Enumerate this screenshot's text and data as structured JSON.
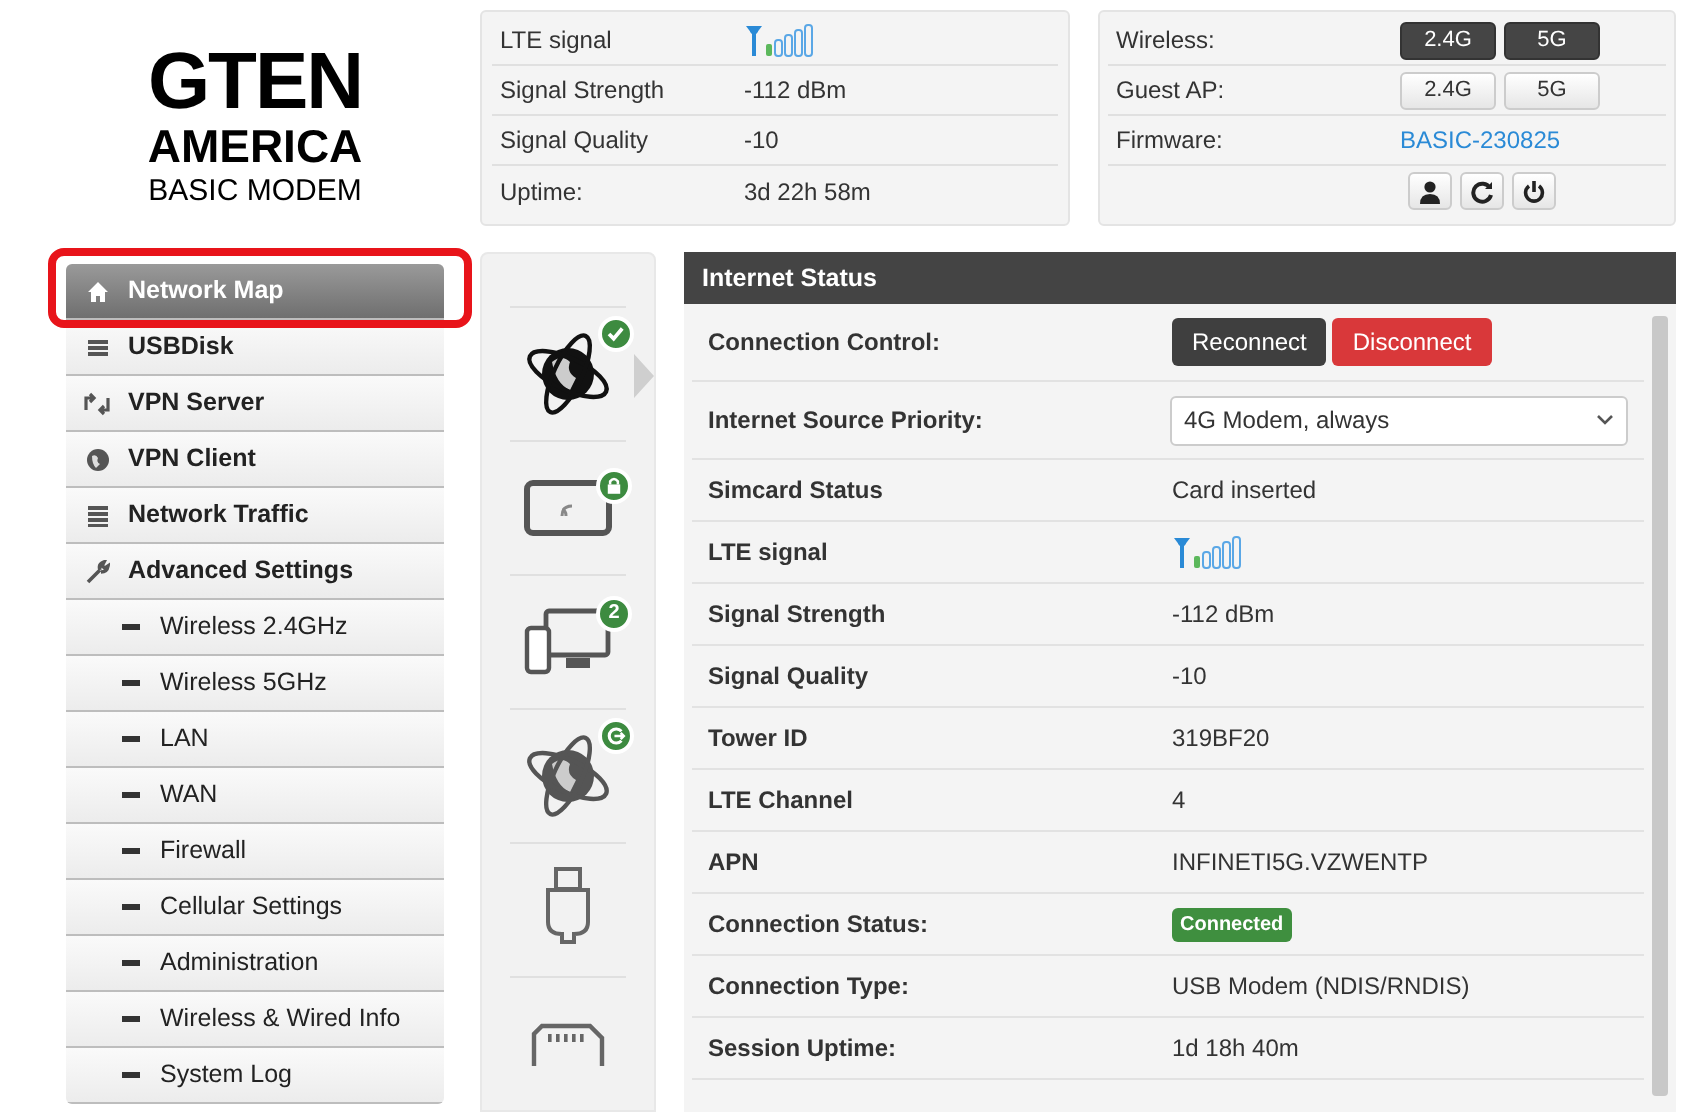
{
  "logo": {
    "brand": "GTEN",
    "region": "AMERICA",
    "product": "BASIC MODEM"
  },
  "signal_panel": [
    {
      "label": "LTE signal",
      "kind": "signal"
    },
    {
      "label": "Signal Strength",
      "kind": "text",
      "value": "-112 dBm"
    },
    {
      "label": "Signal Quality",
      "kind": "text",
      "value": "-10"
    },
    {
      "label": "Uptime:",
      "kind": "text",
      "value": "3d 22h 58m"
    }
  ],
  "system_panel": {
    "rows": [
      {
        "label": "Wireless:",
        "kind": "toggles",
        "toggles": [
          {
            "label": "2.4G",
            "on": true
          },
          {
            "label": "5G",
            "on": true
          }
        ]
      },
      {
        "label": "Guest AP:",
        "kind": "toggles",
        "toggles": [
          {
            "label": "2.4G",
            "on": false
          },
          {
            "label": "5G",
            "on": false
          }
        ]
      },
      {
        "label": "Firmware:",
        "kind": "link",
        "value": "BASIC-230825"
      }
    ],
    "actions": [
      {
        "kind": "user"
      },
      {
        "kind": "refresh"
      },
      {
        "kind": "power"
      }
    ]
  },
  "sidebar": {
    "highlighted": true,
    "items": [
      {
        "label": "Network Map",
        "kind": "main",
        "selected": true
      },
      {
        "label": "USBDisk",
        "kind": "main",
        "selected": false
      },
      {
        "label": "VPN Server",
        "kind": "main",
        "selected": false
      },
      {
        "label": "VPN Client",
        "kind": "main",
        "selected": false
      },
      {
        "label": "Network Traffic",
        "kind": "main",
        "selected": false
      },
      {
        "label": "Advanced Settings",
        "kind": "main",
        "selected": false,
        "children": [
          {
            "label": "Wireless 2.4GHz",
            "kind": "sub",
            "selected": false
          },
          {
            "label": "Wireless 5GHz",
            "kind": "sub",
            "selected": false
          },
          {
            "label": "LAN",
            "kind": "sub",
            "selected": false
          },
          {
            "label": "WAN",
            "kind": "sub",
            "selected": false
          },
          {
            "label": "Firewall",
            "kind": "sub",
            "selected": false
          },
          {
            "label": "Cellular Settings",
            "kind": "sub",
            "selected": false
          },
          {
            "label": "Administration",
            "kind": "sub",
            "selected": false
          },
          {
            "label": "Wireless & Wired Info",
            "kind": "sub",
            "selected": false
          },
          {
            "label": "System Log",
            "kind": "sub",
            "selected": false
          }
        ]
      }
    ]
  },
  "network_map": [
    {
      "kind": "internet",
      "selected": true
    },
    {
      "kind": "sim",
      "selected": false
    },
    {
      "kind": "clients",
      "count": "2",
      "selected": false
    },
    {
      "kind": "wan",
      "selected": false
    },
    {
      "kind": "usb",
      "selected": false
    },
    {
      "kind": "sdcard",
      "selected": false
    }
  ],
  "internet_status": {
    "title": "Internet Status",
    "rows": [
      {
        "label": "Connection Control:",
        "kind": "buttons",
        "buttons": [
          {
            "label": "Reconnect",
            "kind": "dark"
          },
          {
            "label": "Disconnect",
            "kind": "danger"
          }
        ]
      },
      {
        "label": "Internet Source Priority:",
        "kind": "select",
        "value": "4G Modem, always"
      },
      {
        "label": "Simcard Status",
        "kind": "text",
        "value": "Card inserted"
      },
      {
        "label": "LTE signal",
        "kind": "signal"
      },
      {
        "label": "Signal Strength",
        "kind": "text",
        "value": "-112 dBm"
      },
      {
        "label": "Signal Quality",
        "kind": "text",
        "value": "-10"
      },
      {
        "label": "Tower ID",
        "kind": "text",
        "value": "319BF20"
      },
      {
        "label": "LTE Channel",
        "kind": "text",
        "value": "4"
      },
      {
        "label": "APN",
        "kind": "text",
        "value": "INFINETI5G.VZWENTP"
      },
      {
        "label": "Connection Status:",
        "kind": "badge",
        "value": "Connected"
      },
      {
        "label": "Connection Type:",
        "kind": "text",
        "value": "USB Modem (NDIS/RNDIS)"
      },
      {
        "label": "Session Uptime:",
        "kind": "text",
        "value": "1d 18h 40m"
      }
    ]
  }
}
